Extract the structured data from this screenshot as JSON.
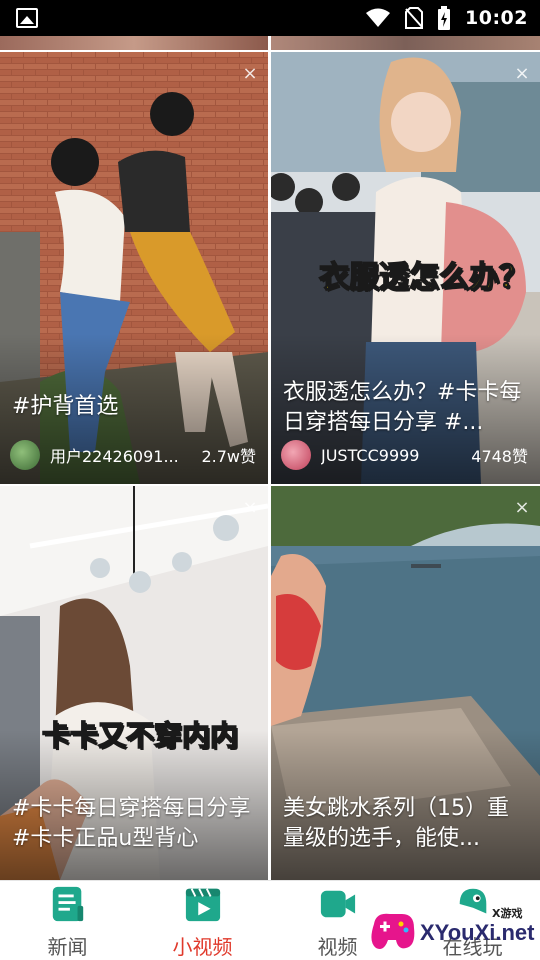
{
  "status_bar": {
    "time": "10:02"
  },
  "feed": {
    "cards": [
      {
        "caption": "#护背首选",
        "author": "用户22426091...",
        "likes": "2.7w赞",
        "overlay": ""
      },
      {
        "caption": "衣服透怎么办？#卡卡每日穿搭每日分享 #...",
        "author": "JUSTCC9999",
        "likes": "4748赞",
        "overlay": "衣服透怎么办？"
      },
      {
        "caption": "#卡卡每日穿搭每日分享 #卡卡正品u型背心",
        "author": "",
        "likes": "",
        "overlay": "卡卡又不穿内内"
      },
      {
        "caption": "美女跳水系列（15）重量级的选手，能使...",
        "author": "",
        "likes": "",
        "overlay": ""
      }
    ]
  },
  "tabs": [
    {
      "label": "新闻",
      "icon": "news-icon",
      "active": false
    },
    {
      "label": "小视频",
      "icon": "short-video-icon",
      "active": true
    },
    {
      "label": "视频",
      "icon": "video-camera-icon",
      "active": false
    },
    {
      "label": "在线玩",
      "icon": "game-icon",
      "active": false
    }
  ],
  "watermark": {
    "brand": "XYouXi.net",
    "small": "X游戏"
  },
  "colors": {
    "accent": "#e0392b",
    "icon_teal": "#1fa88c"
  }
}
